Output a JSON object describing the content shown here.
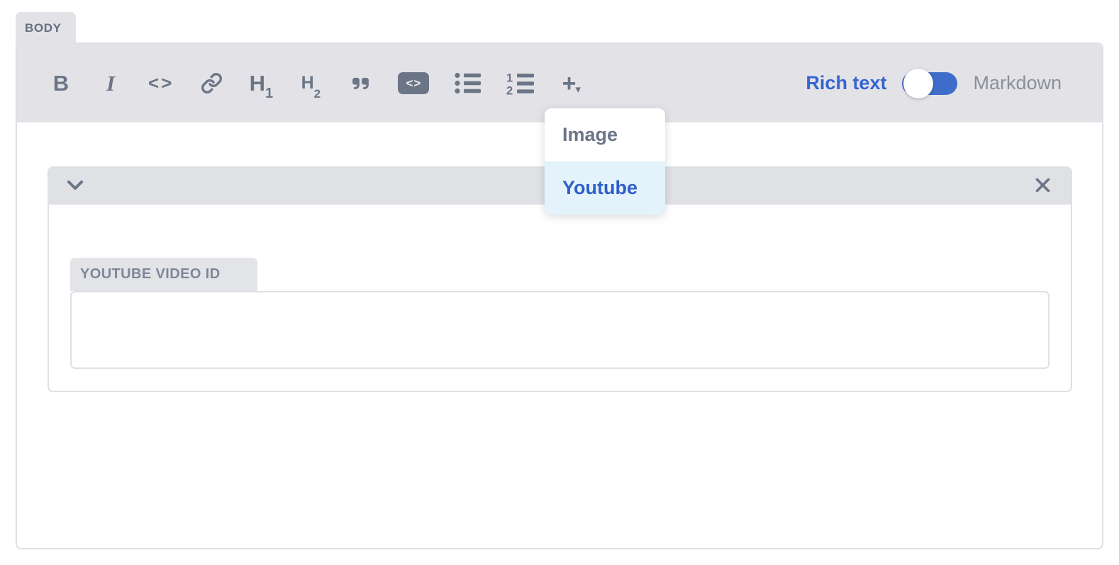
{
  "body_field": {
    "tab_label": "BODY"
  },
  "toolbar": {
    "bold_glyph": "B",
    "italic_glyph": "I",
    "inline_code_glyph": "<>",
    "h1": {
      "letter": "H",
      "digit": "1"
    },
    "h2": {
      "letter": "H",
      "digit": "2"
    },
    "quote_icon": "blockquote",
    "code_block_glyph": "<>",
    "bullet_list_icon": "unordered-list",
    "ordered_list": {
      "n1": "1",
      "n2": "2"
    },
    "insert": {
      "plus_glyph": "+",
      "caret_glyph": "▾"
    }
  },
  "mode_toggle": {
    "rich_text_label": "Rich text",
    "markdown_label": "Markdown",
    "selected_mode": "Rich text"
  },
  "insert_menu": {
    "items": [
      {
        "label": "Image",
        "highlighted": false
      },
      {
        "label": "Youtube",
        "highlighted": true
      }
    ]
  },
  "youtube_block": {
    "label": "YOUTUBE VIDEO ID",
    "video_id_value": ""
  },
  "colors": {
    "accent_blue_text": "#3465d2",
    "toggle_track_blue": "#3e6ec9",
    "menu_highlight_bg": "#e3f2fb",
    "chrome_gray": "#e3e3e7",
    "icon_slate": "#6b7586"
  }
}
